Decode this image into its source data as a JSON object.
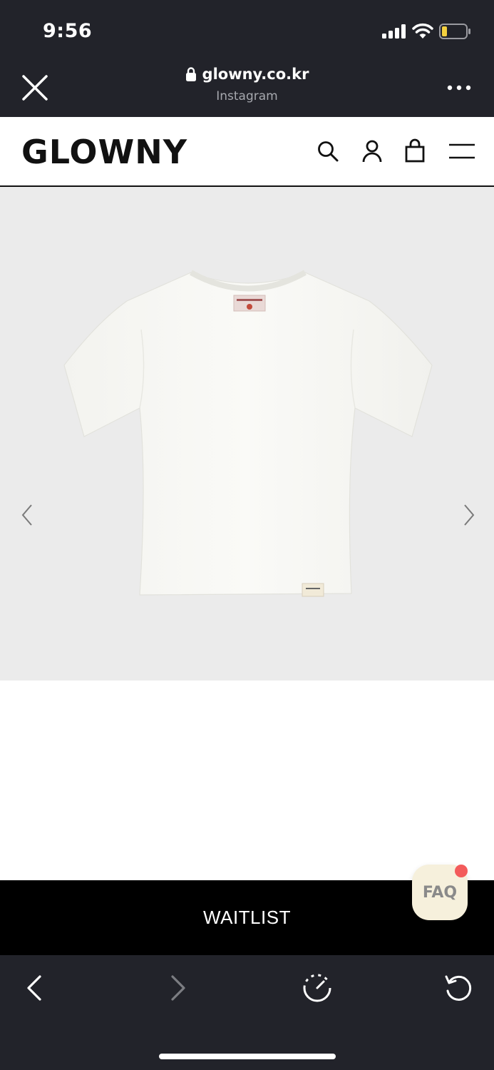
{
  "status_bar": {
    "time": "9:56",
    "icons": [
      "signal-icon",
      "wifi-icon",
      "battery-icon"
    ],
    "battery_color": "#f4d03f"
  },
  "browser": {
    "url": "glowny.co.kr",
    "source": "Instagram",
    "icons": [
      "close-icon",
      "lock-icon",
      "more-icon"
    ]
  },
  "site": {
    "logo": "GLOWNY",
    "header_icons": [
      "search-icon",
      "account-icon",
      "bag-icon",
      "menu-icon"
    ]
  },
  "product_gallery": {
    "image": "white short-sleeve t-shirt",
    "arrows": [
      "chevron-left-icon",
      "chevron-right-icon"
    ],
    "background": "#ebebeb"
  },
  "waitlist": {
    "label": "WAITLIST"
  },
  "faq": {
    "label": "FAQ",
    "badge_color": "#f35b5b"
  },
  "toolbar": {
    "icons": [
      "back-icon",
      "forward-icon",
      "compass-icon",
      "reload-icon"
    ]
  }
}
